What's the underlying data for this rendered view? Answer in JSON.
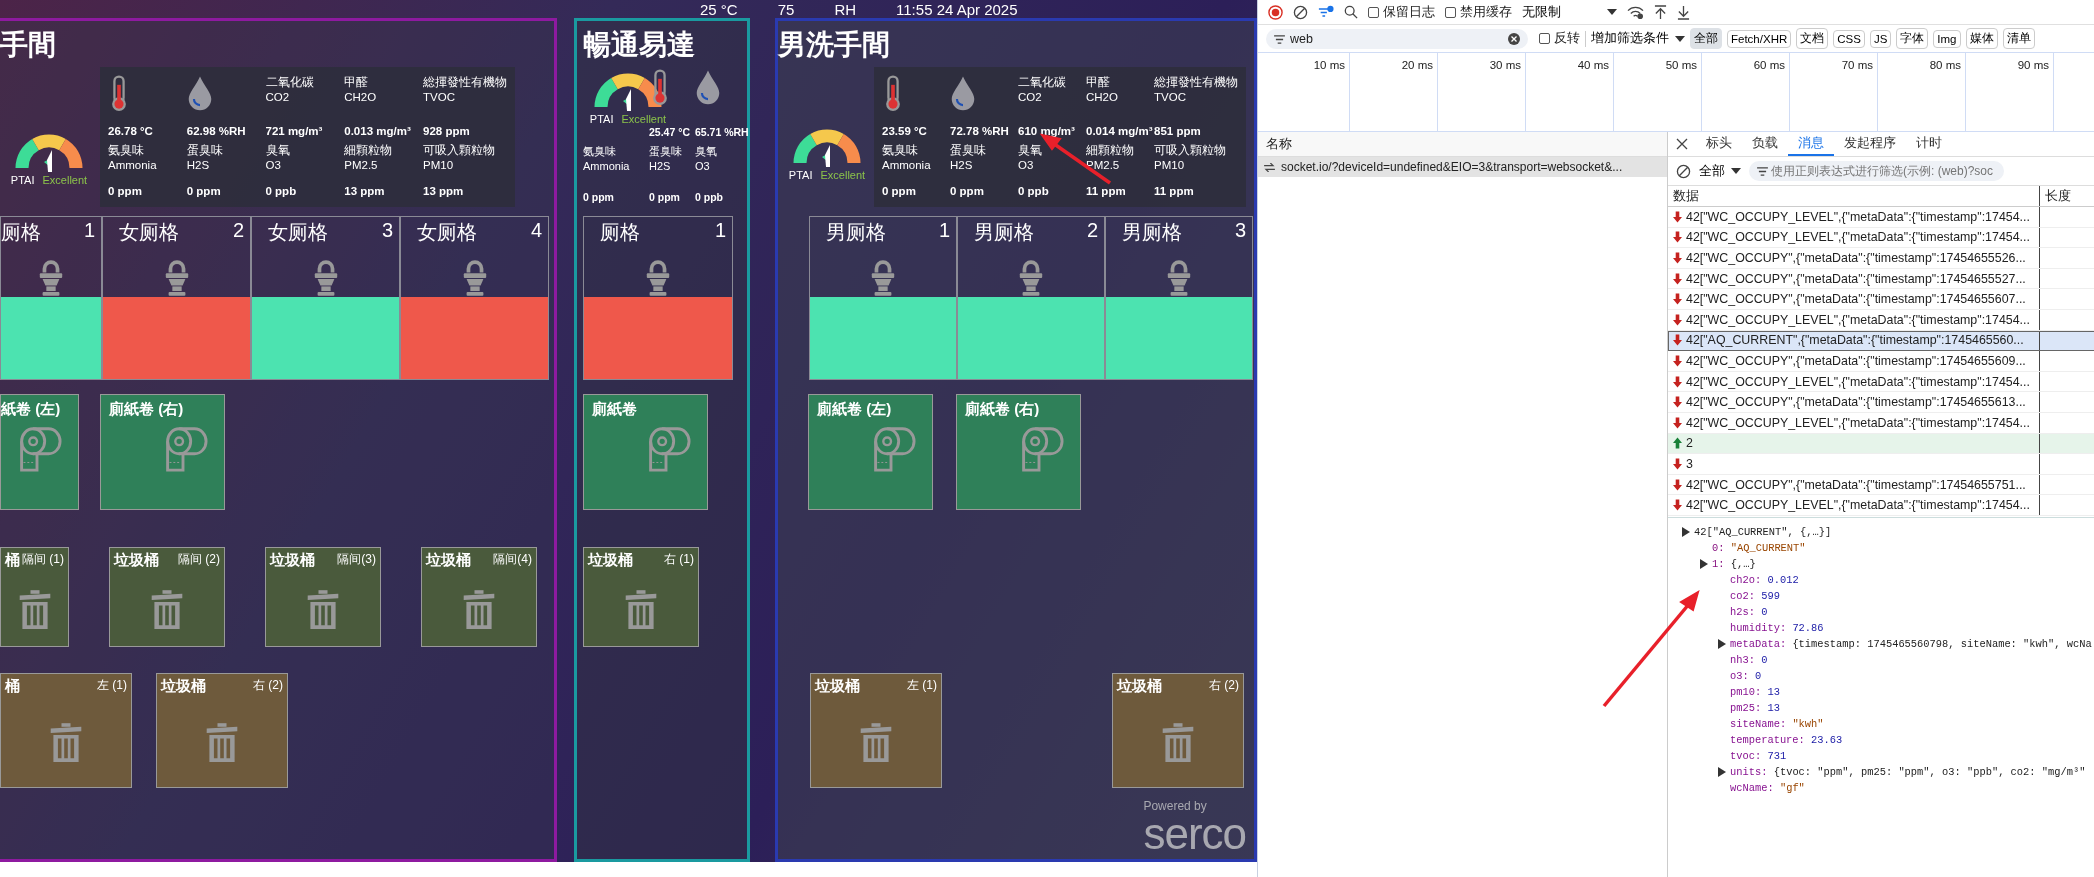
{
  "dashboard": {
    "header": {
      "temperature": "25 °C",
      "humidity": "75",
      "humidity_unit": "RH",
      "datetime": "11:55 24 Apr 2025"
    },
    "panels": [
      {
        "title": "手間",
        "color": "#8e1aa0",
        "clipped": true,
        "gauge": {
          "label": "PTAI",
          "rating": "Excellent"
        },
        "sensors": [
          {
            "kind": "temperature",
            "value": "26.78 °C"
          },
          {
            "kind": "humidity",
            "value": "62.98 %RH"
          },
          {
            "kind": "gas",
            "name": "二氧化碳",
            "formula": "CO2",
            "value": "721 mg/m³"
          },
          {
            "kind": "gas",
            "name": "甲醛",
            "formula": "CH2O",
            "value": "0.013 mg/m³"
          },
          {
            "kind": "gas",
            "name": "総揮發性有機物",
            "formula": "TVOC",
            "value": "928 ppm"
          },
          {
            "kind": "gas",
            "name": "氨臭味",
            "formula": "Ammonia",
            "value": "0 ppm"
          },
          {
            "kind": "gas",
            "name": "蛋臭味",
            "formula": "H2S",
            "value": "0 ppm"
          },
          {
            "kind": "gas",
            "name": "臭氧",
            "formula": "O3",
            "value": "0 ppb"
          },
          {
            "kind": "gas",
            "name": "細顆粒物",
            "formula": "PM2.5",
            "value": "13 ppm"
          },
          {
            "kind": "gas",
            "name": "可吸入顆粒物",
            "formula": "PM10",
            "value": "13 ppm"
          }
        ],
        "stalls": [
          {
            "label": "厕格",
            "number": "1",
            "occupied": false
          },
          {
            "label": "女厕格",
            "number": "2",
            "occupied": true
          },
          {
            "label": "女厕格",
            "number": "3",
            "occupied": false
          },
          {
            "label": "女厕格",
            "number": "4",
            "occupied": true
          }
        ],
        "paper_rolls": [
          {
            "label": "紙卷 (左)"
          },
          {
            "label": "廁紙卷 (右)"
          }
        ],
        "bins": [
          {
            "kind": "compartment",
            "label": "桶",
            "tag": "隔间 (1)"
          },
          {
            "kind": "compartment",
            "label": "垃圾桶",
            "tag": "隔间 (2)"
          },
          {
            "kind": "compartment",
            "label": "垃圾桶",
            "tag": "隔间(3)"
          },
          {
            "kind": "compartment",
            "label": "垃圾桶",
            "tag": "隔间(4)"
          },
          {
            "kind": "floor",
            "label": "桶",
            "tag": "左 (1)"
          },
          {
            "kind": "floor",
            "label": "垃圾桶",
            "tag": "右 (2)"
          }
        ]
      },
      {
        "title": "暢通易達",
        "color": "#1a9aa0",
        "clipped": false,
        "sensors": [
          {
            "kind": "gauge",
            "label": "PTAI",
            "rating": "Excellent"
          },
          {
            "kind": "temperature",
            "value": "25.47 °C"
          },
          {
            "kind": "humidity",
            "value": "65.71 %RH"
          },
          {
            "kind": "gas",
            "name": "氨臭味",
            "formula": "Ammonia",
            "value": "0 ppm"
          },
          {
            "kind": "gas",
            "name": "蛋臭味",
            "formula": "H2S",
            "value": "0 ppm"
          },
          {
            "kind": "gas",
            "name": "臭氧",
            "formula": "O3",
            "value": "0 ppb"
          }
        ],
        "stalls": [
          {
            "label": "厕格",
            "number": "1",
            "occupied": true
          }
        ],
        "paper_rolls": [
          {
            "label": "廁紙卷"
          }
        ],
        "bins": [
          {
            "kind": "compartment",
            "label": "垃圾桶",
            "tag": "右 (1)"
          }
        ]
      },
      {
        "title": "男洗手間",
        "color": "#2a3ab0",
        "clipped": false,
        "gauge": {
          "label": "PTAI",
          "rating": "Excellent"
        },
        "sensors": [
          {
            "kind": "temperature",
            "value": "23.59 °C"
          },
          {
            "kind": "humidity",
            "value": "72.78 %RH"
          },
          {
            "kind": "gas",
            "name": "二氧化碳",
            "formula": "CO2",
            "value": "610 mg/m³"
          },
          {
            "kind": "gas",
            "name": "甲醛",
            "formula": "CH2O",
            "value": "0.014 mg/m³"
          },
          {
            "kind": "gas",
            "name": "総揮發性有機物",
            "formula": "TVOC",
            "value": "851 ppm"
          },
          {
            "kind": "gas",
            "name": "氨臭味",
            "formula": "Ammonia",
            "value": "0 ppm"
          },
          {
            "kind": "gas",
            "name": "蛋臭味",
            "formula": "H2S",
            "value": "0 ppm"
          },
          {
            "kind": "gas",
            "name": "臭氧",
            "formula": "O3",
            "value": "0 ppb"
          },
          {
            "kind": "gas",
            "name": "細顆粒物",
            "formula": "PM2.5",
            "value": "11 ppm"
          },
          {
            "kind": "gas",
            "name": "可吸入顆粒物",
            "formula": "PM10",
            "value": "11 ppm"
          }
        ],
        "stalls": [
          {
            "label": "男厕格",
            "number": "1",
            "occupied": false
          },
          {
            "label": "男厕格",
            "number": "2",
            "occupied": false
          },
          {
            "label": "男厕格",
            "number": "3",
            "occupied": false
          }
        ],
        "paper_rolls": [
          {
            "label": "廁紙卷 (左)"
          },
          {
            "label": "廁紙卷 (右)"
          }
        ],
        "bins": [
          {
            "kind": "floor",
            "label": "垃圾桶",
            "tag": "左 (1)"
          },
          {
            "kind": "floor",
            "label": "垃圾桶",
            "tag": "右 (2)"
          }
        ],
        "footer": {
          "caption": "Powered by",
          "brand": "serco"
        }
      }
    ]
  },
  "devtools": {
    "toolbar": {
      "options": [
        {
          "label": "保留日志",
          "checked": false
        },
        {
          "label": "禁用缓存",
          "checked": false
        }
      ],
      "throttling": "无限制"
    },
    "filter": {
      "value": "web",
      "invert": {
        "label": "反转",
        "checked": false
      },
      "more_filters": "增加筛选条件",
      "types": [
        {
          "label": "全部",
          "selected": true
        },
        {
          "label": "Fetch/XHR",
          "selected": false
        },
        {
          "label": "文档",
          "selected": false
        },
        {
          "label": "CSS",
          "selected": false
        },
        {
          "label": "JS",
          "selected": false
        },
        {
          "label": "字体",
          "selected": false
        },
        {
          "label": "Img",
          "selected": false
        },
        {
          "label": "媒体",
          "selected": false
        },
        {
          "label": "清单",
          "selected": false
        }
      ]
    },
    "timeline_ticks": [
      "10 ms",
      "20 ms",
      "30 ms",
      "40 ms",
      "50 ms",
      "60 ms",
      "70 ms",
      "80 ms",
      "90 ms"
    ],
    "requests": {
      "header": "名称",
      "rows": [
        {
          "name": "socket.io/?deviceId=undefined&EIO=3&transport=websocket&...",
          "selected": true
        }
      ]
    },
    "detail": {
      "tabs": [
        {
          "label": "标头",
          "selected": false
        },
        {
          "label": "负载",
          "selected": false
        },
        {
          "label": "消息",
          "selected": true
        },
        {
          "label": "发起程序",
          "selected": false
        },
        {
          "label": "计时",
          "selected": false
        }
      ],
      "message_filter": {
        "type": "全部",
        "placeholder": "使用正则表达式进行筛选(示例: (web)?soc"
      },
      "columns": [
        "数据",
        "长度"
      ],
      "messages": [
        {
          "kind": "received",
          "text": "42[\"WC_OCCUPY_LEVEL\",{\"metaData\":{\"timestamp\":17454...",
          "selected": false
        },
        {
          "kind": "received",
          "text": "42[\"WC_OCCUPY_LEVEL\",{\"metaData\":{\"timestamp\":17454...",
          "selected": false
        },
        {
          "kind": "received",
          "text": "42[\"WC_OCCUPY\",{\"metaData\":{\"timestamp\":17454655526...",
          "selected": false
        },
        {
          "kind": "received",
          "text": "42[\"WC_OCCUPY\",{\"metaData\":{\"timestamp\":17454655527...",
          "selected": false
        },
        {
          "kind": "received",
          "text": "42[\"WC_OCCUPY\",{\"metaData\":{\"timestamp\":17454655607...",
          "selected": false
        },
        {
          "kind": "received",
          "text": "42[\"WC_OCCUPY_LEVEL\",{\"metaData\":{\"timestamp\":17454...",
          "selected": false
        },
        {
          "kind": "received",
          "text": "42[\"AQ_CURRENT\",{\"metaData\":{\"timestamp\":1745465560...",
          "selected": true
        },
        {
          "kind": "received",
          "text": "42[\"WC_OCCUPY\",{\"metaData\":{\"timestamp\":17454655609...",
          "selected": false
        },
        {
          "kind": "received",
          "text": "42[\"WC_OCCUPY_LEVEL\",{\"metaData\":{\"timestamp\":17454...",
          "selected": false
        },
        {
          "kind": "received",
          "text": "42[\"WC_OCCUPY\",{\"metaData\":{\"timestamp\":17454655613...",
          "selected": false
        },
        {
          "kind": "received",
          "text": "42[\"WC_OCCUPY_LEVEL\",{\"metaData\":{\"timestamp\":17454...",
          "selected": false
        },
        {
          "kind": "sent",
          "text": "2",
          "selected": false
        },
        {
          "kind": "received",
          "text": "3",
          "selected": false
        },
        {
          "kind": "received",
          "text": "42[\"WC_OCCUPY\",{\"metaData\":{\"timestamp\":17454655751...",
          "selected": false
        },
        {
          "kind": "received",
          "text": "42[\"WC_OCCUPY_LEVEL\",{\"metaData\":{\"timestamp\":17454...",
          "selected": false
        }
      ],
      "payload": [
        {
          "key": "42[\"AQ_CURRENT\", {,…}]",
          "kind": "object",
          "children": [
            {
              "key": "0:",
              "kind": "string",
              "value": "\"AQ_CURRENT\""
            },
            {
              "key": "1:",
              "kind": "object",
              "value": "{,…}",
              "children": [
                {
                  "key": "ch2o:",
                  "kind": "number",
                  "value": "0.012"
                },
                {
                  "key": "co2:",
                  "kind": "number",
                  "value": "599"
                },
                {
                  "key": "h2s:",
                  "kind": "number",
                  "value": "0"
                },
                {
                  "key": "humidity:",
                  "kind": "number",
                  "value": "72.86"
                },
                {
                  "key": "metaData:",
                  "kind": "object",
                  "value": "{timestamp: 1745465560798, siteName: \"kwh\", wcNa"
                },
                {
                  "key": "nh3:",
                  "kind": "number",
                  "value": "0"
                },
                {
                  "key": "o3:",
                  "kind": "number",
                  "value": "0"
                },
                {
                  "key": "pm10:",
                  "kind": "number",
                  "value": "13"
                },
                {
                  "key": "pm25:",
                  "kind": "number",
                  "value": "13"
                },
                {
                  "key": "siteName:",
                  "kind": "string",
                  "value": "\"kwh\""
                },
                {
                  "key": "temperature:",
                  "kind": "number",
                  "value": "23.63"
                },
                {
                  "key": "tvoc:",
                  "kind": "number",
                  "value": "731"
                },
                {
                  "key": "units:",
                  "kind": "object",
                  "value": "{tvoc: \"ppm\", pm25: \"ppm\", o3: \"ppb\", co2: \"mg/m³\""
                },
                {
                  "key": "wcName:",
                  "kind": "string",
                  "value": "\"gf\""
                }
              ]
            }
          ]
        }
      ]
    }
  }
}
